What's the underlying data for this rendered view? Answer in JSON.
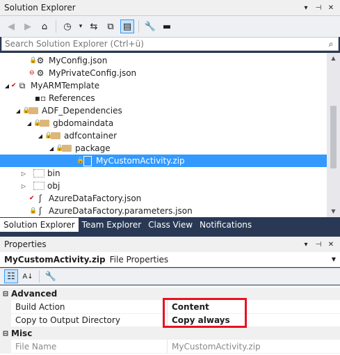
{
  "solution_explorer": {
    "title": "Solution Explorer",
    "search_placeholder": "Search Solution Explorer (Ctrl+ü)",
    "tree": [
      {
        "label": "MyConfig.json"
      },
      {
        "label": "MyPrivateConfig.json"
      },
      {
        "label": "MyARMTemplate"
      },
      {
        "label": "References"
      },
      {
        "label": "ADF_Dependencies"
      },
      {
        "label": "gbdomaindata"
      },
      {
        "label": "adfcontainer"
      },
      {
        "label": "package"
      },
      {
        "label": "MyCustomActivity.zip"
      },
      {
        "label": "bin"
      },
      {
        "label": "obj"
      },
      {
        "label": "AzureDataFactory.json"
      },
      {
        "label": "AzureDataFactory.parameters.json"
      }
    ]
  },
  "tabs": [
    "Solution Explorer",
    "Team Explorer",
    "Class View",
    "Notifications"
  ],
  "properties": {
    "title": "Properties",
    "object_name": "MyCustomActivity.zip",
    "object_type": "File Properties",
    "categories": [
      {
        "name": "Advanced",
        "rows": [
          {
            "name": "Build Action",
            "value": "Content"
          },
          {
            "name": "Copy to Output Directory",
            "value": "Copy always"
          }
        ]
      },
      {
        "name": "Misc",
        "rows": [
          {
            "name": "File Name",
            "value": "MyCustomActivity.zip"
          }
        ]
      }
    ]
  },
  "colors": {
    "accent": "#3399ff",
    "highlight": "#e81123",
    "frame": "#293955"
  }
}
